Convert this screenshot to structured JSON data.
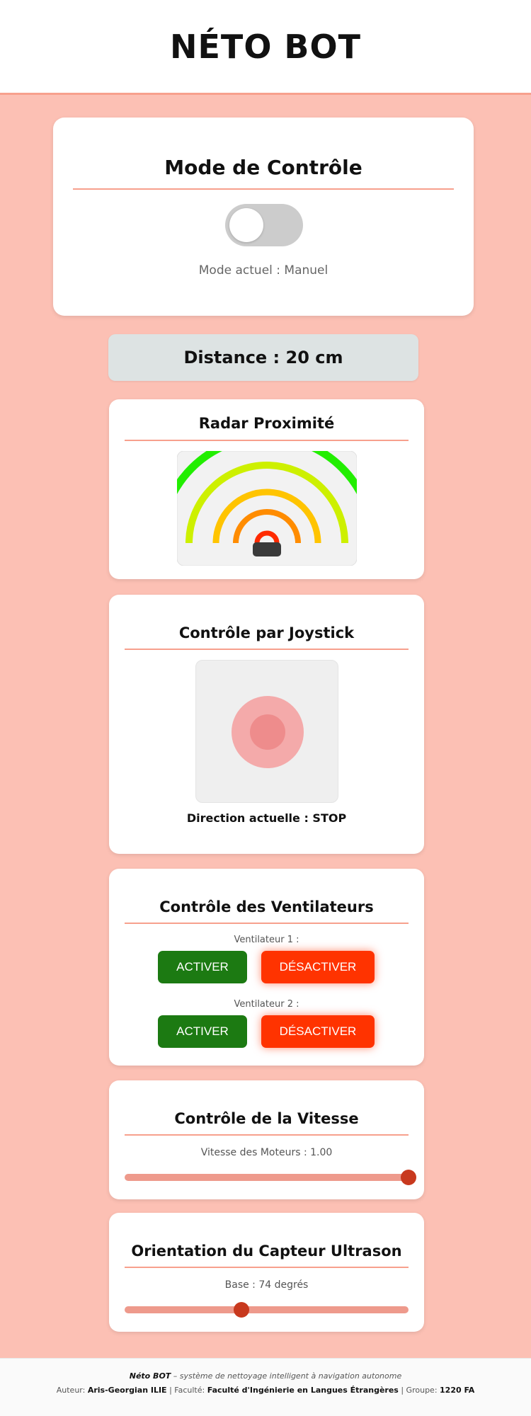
{
  "header": {
    "title": "NÉTO BOT"
  },
  "mode": {
    "title": "Mode de Contrôle",
    "status": "Mode actuel : Manuel",
    "toggle_on": false
  },
  "distance": {
    "text": "Distance : 20 cm",
    "value_cm": 20
  },
  "radar": {
    "title": "Radar Proximité",
    "arc_colors": [
      "#ff2a00",
      "#ff8c00",
      "#ffc400",
      "#cdf000",
      "#22ee00"
    ]
  },
  "joystick": {
    "title": "Contrôle par Joystick",
    "direction": "Direction actuelle : STOP"
  },
  "fans": {
    "title": "Contrôle des Ventilateurs",
    "items": [
      {
        "label": "Ventilateur 1 :",
        "on_label": "ACTIVER",
        "off_label": "DÉSACTIVER"
      },
      {
        "label": "Ventilateur 2 :",
        "on_label": "ACTIVER",
        "off_label": "DÉSACTIVER"
      }
    ]
  },
  "speed": {
    "title": "Contrôle de la Vitesse",
    "value_text": "Vitesse des Moteurs : 1.00",
    "value": 1.0,
    "min": 0,
    "max": 1
  },
  "ultrasonic": {
    "title": "Orientation du Capteur Ultrason",
    "value_text": "Base : 74 degrés",
    "value": 74,
    "min": 0,
    "max": 180
  },
  "footer": {
    "brand": "Néto BOT",
    "tagline": " – système de nettoyage intelligent à navigation autonome",
    "author_label": "Auteur: ",
    "author": "Aris-Georgian ILIE",
    "faculty_label": " | Faculté: ",
    "faculty": "Faculté d'Ingénierie en Langues Étrangères",
    "group_label": " | Groupe: ",
    "group": "1220 FA"
  },
  "colors": {
    "background": "#fcc0b4",
    "accent_rule": "#f7a08d",
    "activate": "#1c7a12",
    "deactivate": "#ff3300",
    "slider_thumb": "#c8391e"
  }
}
